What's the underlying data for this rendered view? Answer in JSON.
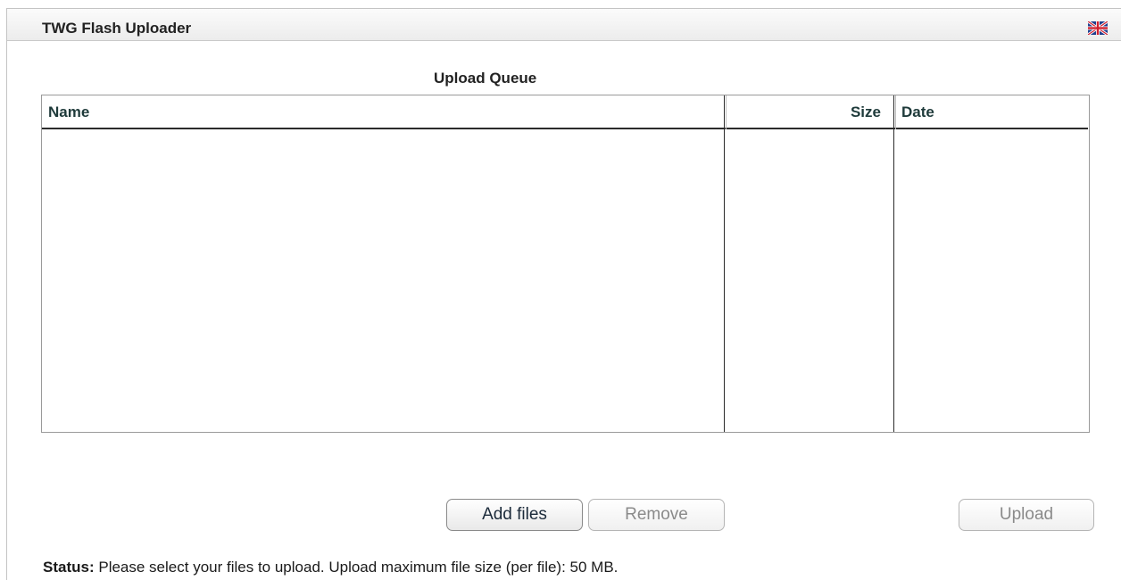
{
  "app": {
    "title": "TWG Flash Uploader",
    "language_flag": "uk-flag-icon"
  },
  "queue": {
    "title": "Upload Queue",
    "columns": {
      "name": "Name",
      "size": "Size",
      "date": "Date"
    },
    "rows": []
  },
  "buttons": {
    "add_files": "Add files",
    "remove": "Remove",
    "upload": "Upload"
  },
  "status": {
    "label": "Status:",
    "message": "Please select your files to upload.  Upload maximum file size (per file): 50 MB."
  },
  "colors": {
    "title_bar": "#ececec",
    "header_text": "#1e3a3a",
    "border": "#9a9a9a",
    "disabled_text": "#8a8a8a"
  }
}
